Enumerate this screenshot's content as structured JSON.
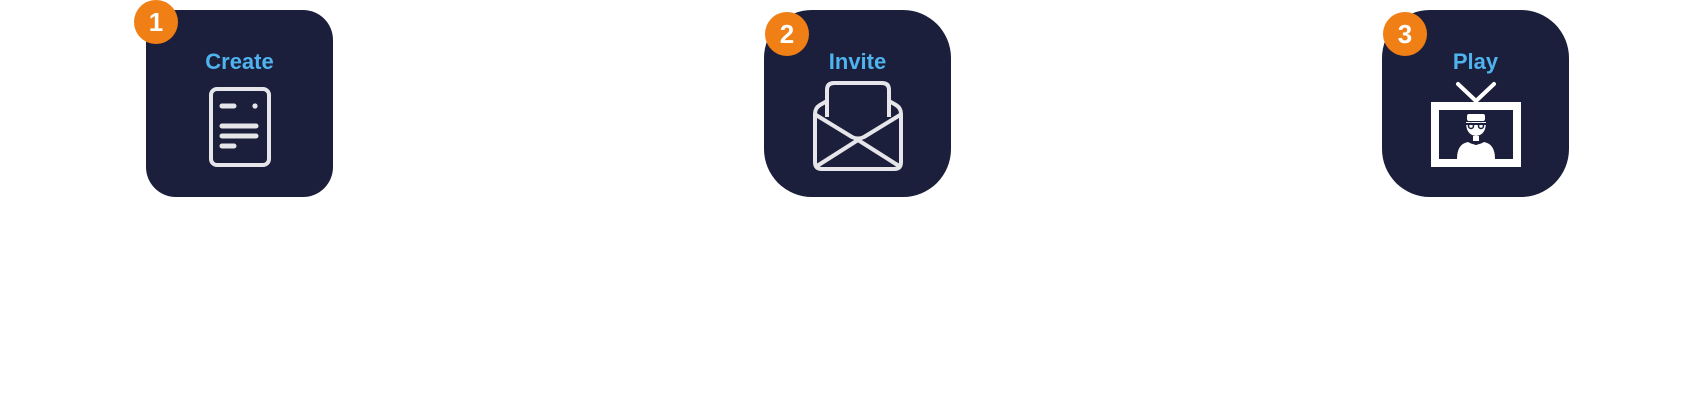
{
  "steps": [
    {
      "number": "1",
      "label": "Create",
      "icon": "document-icon"
    },
    {
      "number": "2",
      "label": "Invite",
      "icon": "open-envelope-icon"
    },
    {
      "number": "3",
      "label": "Play",
      "icon": "tv-person-icon"
    }
  ],
  "colors": {
    "card_background": "#1b1f3b",
    "label_text": "#4fb3ee",
    "badge_background": "#f07f16",
    "badge_text": "#ffffff",
    "icon_stroke": "#e6e6ea",
    "page_background": "#ffffff"
  }
}
